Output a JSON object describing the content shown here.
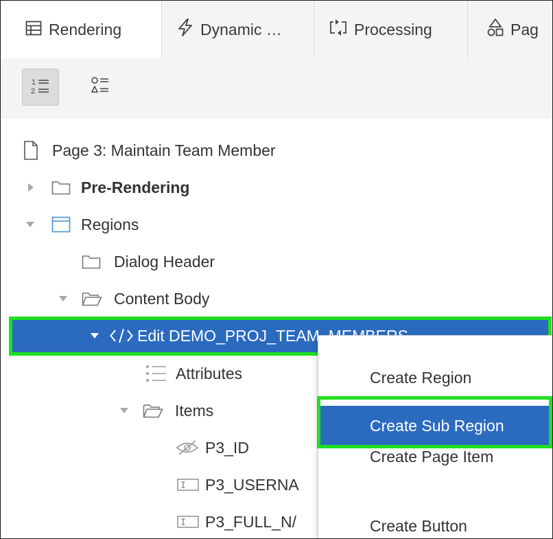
{
  "tabs": [
    {
      "label": "Rendering",
      "icon": "rendering-icon",
      "active": true
    },
    {
      "label": "Dynamic …",
      "icon": "lightning-icon",
      "active": false
    },
    {
      "label": "Processing",
      "icon": "processing-icon",
      "active": false
    },
    {
      "label": "Pag",
      "icon": "shared-components-icon",
      "active": false
    }
  ],
  "toolbar": {
    "view_by_order": "1=2=",
    "view_by_type": "○≡△≡"
  },
  "tree": {
    "page": "Page 3: Maintain Team Member",
    "pre_rendering": "Pre-Rendering",
    "regions": "Regions",
    "dialog_header": "Dialog Header",
    "content_body": "Content Body",
    "edit_region": "Edit DEMO_PROJ_TEAM_MEMBERS",
    "attributes": "Attributes",
    "items": "Items",
    "item_1": "P3_ID",
    "item_2": "P3_USERNA",
    "item_3": "P3_FULL_N/"
  },
  "context_menu": {
    "items": [
      "Create Region",
      "Create Sub Region",
      "Create Page Item",
      "Create Button"
    ],
    "active_index": 1
  },
  "colors": {
    "selection": "#2b6bbf",
    "highlight": "#1ee11e"
  }
}
